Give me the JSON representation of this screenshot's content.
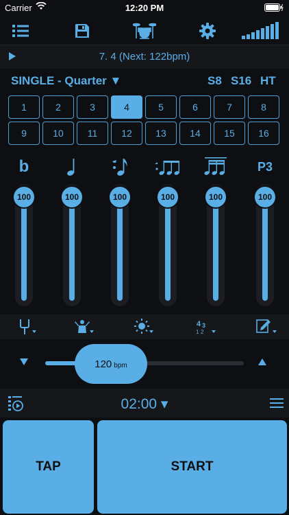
{
  "status": {
    "carrier": "Carrier",
    "time": "12:20 PM"
  },
  "toolbar": {
    "icons": [
      "list-icon",
      "save-icon",
      "drum-kit-icon",
      "gear-icon",
      "volume-bars-icon"
    ]
  },
  "playbar": {
    "title": "7. 4 (Next: 122bpm)"
  },
  "mode": {
    "label": "SINGLE - Quarter ▼",
    "options": [
      "S8",
      "S16",
      "HT"
    ]
  },
  "beats": {
    "active": 4,
    "cells": [
      "1",
      "2",
      "3",
      "4",
      "5",
      "6",
      "7",
      "8",
      "9",
      "10",
      "11",
      "12",
      "13",
      "14",
      "15",
      "16"
    ]
  },
  "voices": [
    {
      "icon": "accent-flat-icon",
      "label": "b"
    },
    {
      "icon": "quarter-note-icon",
      "label": ""
    },
    {
      "icon": "eighth-note-icon",
      "label": ""
    },
    {
      "icon": "triplet-notes-icon",
      "label": ""
    },
    {
      "icon": "sixteenth-notes-icon",
      "label": ""
    },
    {
      "icon": "p3-icon",
      "label": "P3"
    }
  ],
  "sliders": [
    {
      "value": "100",
      "level": 1.0
    },
    {
      "value": "100",
      "level": 1.0
    },
    {
      "value": "100",
      "level": 1.0
    },
    {
      "value": "100",
      "level": 1.0
    },
    {
      "value": "100",
      "level": 1.0
    },
    {
      "value": "100",
      "level": 1.0
    }
  ],
  "tools": [
    "tuning-fork-icon",
    "conductor-icon",
    "brightness-icon",
    "time-signature-icon",
    "edit-icon"
  ],
  "tempo": {
    "value": "120",
    "unit": "bpm",
    "down": "▼",
    "up": "▲",
    "position": 0.33
  },
  "timer": {
    "value": "02:00 ▾"
  },
  "buttons": {
    "tap": "TAP",
    "start": "START"
  },
  "colors": {
    "accent": "#5aaee6",
    "background": "#0e0f12"
  }
}
